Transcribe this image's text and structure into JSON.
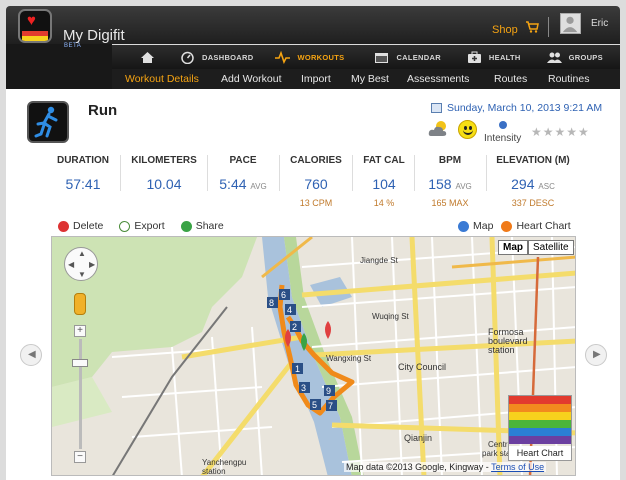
{
  "app": {
    "name": "My Digifit",
    "beta": "BETA",
    "logo_colors": [
      "#e23b2e",
      "#f28b1e",
      "#f7d21d",
      "#4bb53b",
      "#2a7fd4",
      "#6b3fa0"
    ]
  },
  "header": {
    "shop_label": "Shop",
    "user_name": "Eric"
  },
  "mainnav": {
    "items": [
      {
        "label": "",
        "icon": "home-icon"
      },
      {
        "label": "DASHBOARD",
        "icon": "dashboard-icon"
      },
      {
        "label": "WORKOUTS",
        "icon": "workout-pulse-icon",
        "active": true
      },
      {
        "label": "CALENDAR",
        "icon": "calendar-icon"
      },
      {
        "label": "HEALTH",
        "icon": "health-icon"
      },
      {
        "label": "GROUPS",
        "icon": "groups-icon"
      }
    ]
  },
  "subnav": {
    "items": [
      {
        "label": "Workout Details",
        "active": true
      },
      {
        "label": "Add Workout"
      },
      {
        "label": "Import"
      },
      {
        "label": "My Best"
      },
      {
        "label": "Assessments"
      },
      {
        "label": "Routes"
      },
      {
        "label": "Routines"
      }
    ]
  },
  "workout": {
    "title": "Run",
    "date": "Sunday, March 10, 2013 9:21 AM",
    "intensity_label": "Intensity",
    "stars": "★★★★★",
    "rating_stars": 0
  },
  "stats": [
    {
      "label": "DURATION",
      "value": "57:41",
      "unit": "",
      "sub": ""
    },
    {
      "label": "KILOMETERS",
      "value": "10.04",
      "unit": "",
      "sub": ""
    },
    {
      "label": "PACE",
      "value": "5:44",
      "unit": "AVG",
      "sub": ""
    },
    {
      "label": "CALORIES",
      "value": "760",
      "unit": "",
      "sub": "13 CPM"
    },
    {
      "label": "FAT CAL",
      "value": "104",
      "unit": "",
      "sub": "14 %"
    },
    {
      "label": "BPM",
      "value": "158",
      "unit": "AVG",
      "sub": "165 MAX"
    },
    {
      "label": "ELEVATION (M)",
      "value": "294",
      "unit": "ASC",
      "sub": "337 DESC"
    }
  ],
  "actions": {
    "delete": "Delete",
    "export": "Export",
    "share": "Share",
    "map": "Map",
    "heart_chart": "Heart Chart"
  },
  "map": {
    "type_map": "Map",
    "type_satellite": "Satellite",
    "heart_chart_label": "Heart Chart",
    "credit": "Map data ©2013 Google, Kingway - ",
    "terms": "Terms of Use",
    "labels": {
      "jiangde": "Jiangde St",
      "wuqing": "Wuqing St",
      "wangxing": "Wangxing St",
      "city_council": "City Council",
      "formosa1": "Formosa",
      "formosa2": "boulevard",
      "formosa3": "station",
      "qianjin": "Qianjin",
      "yancheng1": "Yanchengpu",
      "yancheng2": "station",
      "centr1": "Centr",
      "centr2": "park static"
    },
    "markers": [
      "8",
      "6",
      "4",
      "2",
      "1",
      "3",
      "9",
      "5",
      "7"
    ]
  }
}
